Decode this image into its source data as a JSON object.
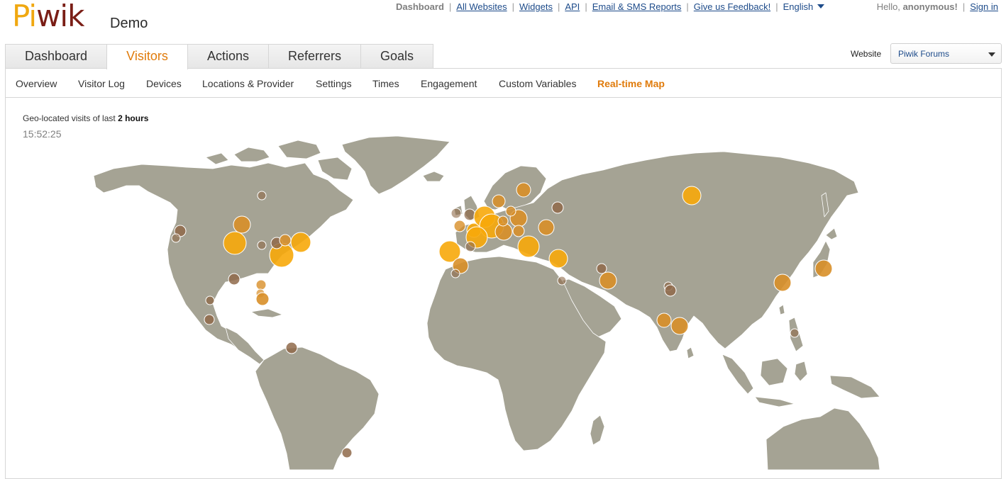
{
  "logo": {
    "part1": "Pi",
    "part2": "wik"
  },
  "app_subtitle": "Demo",
  "top_nav": {
    "items": [
      "Dashboard",
      "All Websites",
      "Widgets",
      "API",
      "Email & SMS Reports",
      "Give us Feedback!"
    ],
    "language": "English"
  },
  "user": {
    "greeting": "Hello,",
    "name": "anonymous!",
    "sign_in": "Sign in"
  },
  "tabs": [
    "Dashboard",
    "Visitors",
    "Actions",
    "Referrers",
    "Goals"
  ],
  "active_tab": "Visitors",
  "website_selector": {
    "label": "Website",
    "value": "Piwik Forums"
  },
  "subnav": [
    "Overview",
    "Visitor Log",
    "Devices",
    "Locations & Provider",
    "Settings",
    "Times",
    "Engagement",
    "Custom Variables",
    "Real-time Map"
  ],
  "active_subnav": "Real-time Map",
  "map": {
    "caption_prefix": "Geo-located visits of last",
    "caption_bold": "2 hours",
    "time": "15:52:25",
    "colors": {
      "land": "#a5a394",
      "recent_visit": "#f7a90a",
      "older_visit": "#d88f28",
      "oldest_visit": "#8f6a4a",
      "ocean": "#ffffff"
    }
  }
}
